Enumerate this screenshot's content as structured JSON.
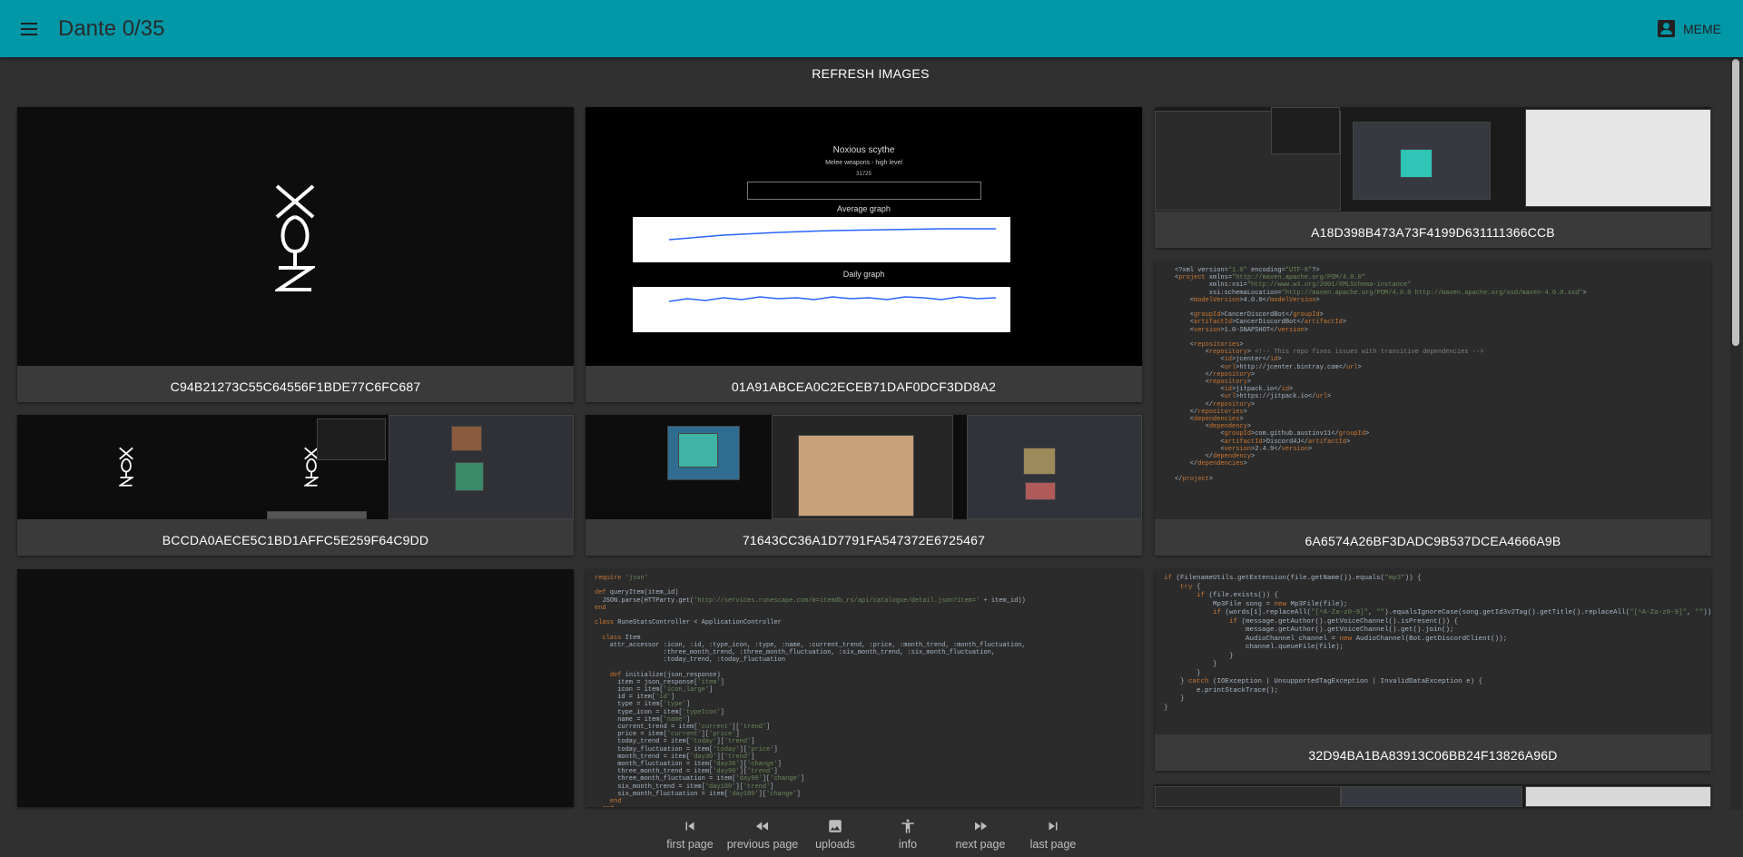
{
  "app": {
    "title": "Dante 0/35",
    "user_label": "MEME"
  },
  "actions": {
    "refresh_label": "REFRESH IMAGES"
  },
  "images": [
    {
      "id": "C94B21273C55C64556F1BDE77C6FC687"
    },
    {
      "id": "01A91ABCEA0C2ECEB71DAF0DCF3DD8A2",
      "preview": {
        "item": "Noxious scythe",
        "category": "Melee weapons - high level",
        "item_id": "31725",
        "avg_heading": "Average graph",
        "daily_heading": "Daily graph"
      }
    },
    {
      "id": "A18D398B473A73F4199D631111366CCB"
    },
    {
      "id": "BCCDA0AECE5C1BD1AFFC5E259F64C9DD"
    },
    {
      "id": "71643CC36A1D7791FA547372E6725467"
    },
    {
      "id": "6A6574A26BF3DADC9B537DCEA4666A9B"
    },
    {
      "id": ""
    },
    {
      "id": ""
    },
    {
      "id": "32D94BA1BA83913C06BB24F13826A96D"
    },
    {
      "id": ""
    }
  ],
  "nav": [
    {
      "label": "first page",
      "icon": "first-page-icon"
    },
    {
      "label": "previous page",
      "icon": "fast-rewind-icon"
    },
    {
      "label": "uploads",
      "icon": "image-icon"
    },
    {
      "label": "info",
      "icon": "accessibility-icon"
    },
    {
      "label": "next page",
      "icon": "fast-forward-icon"
    },
    {
      "label": "last page",
      "icon": "last-page-icon"
    }
  ]
}
